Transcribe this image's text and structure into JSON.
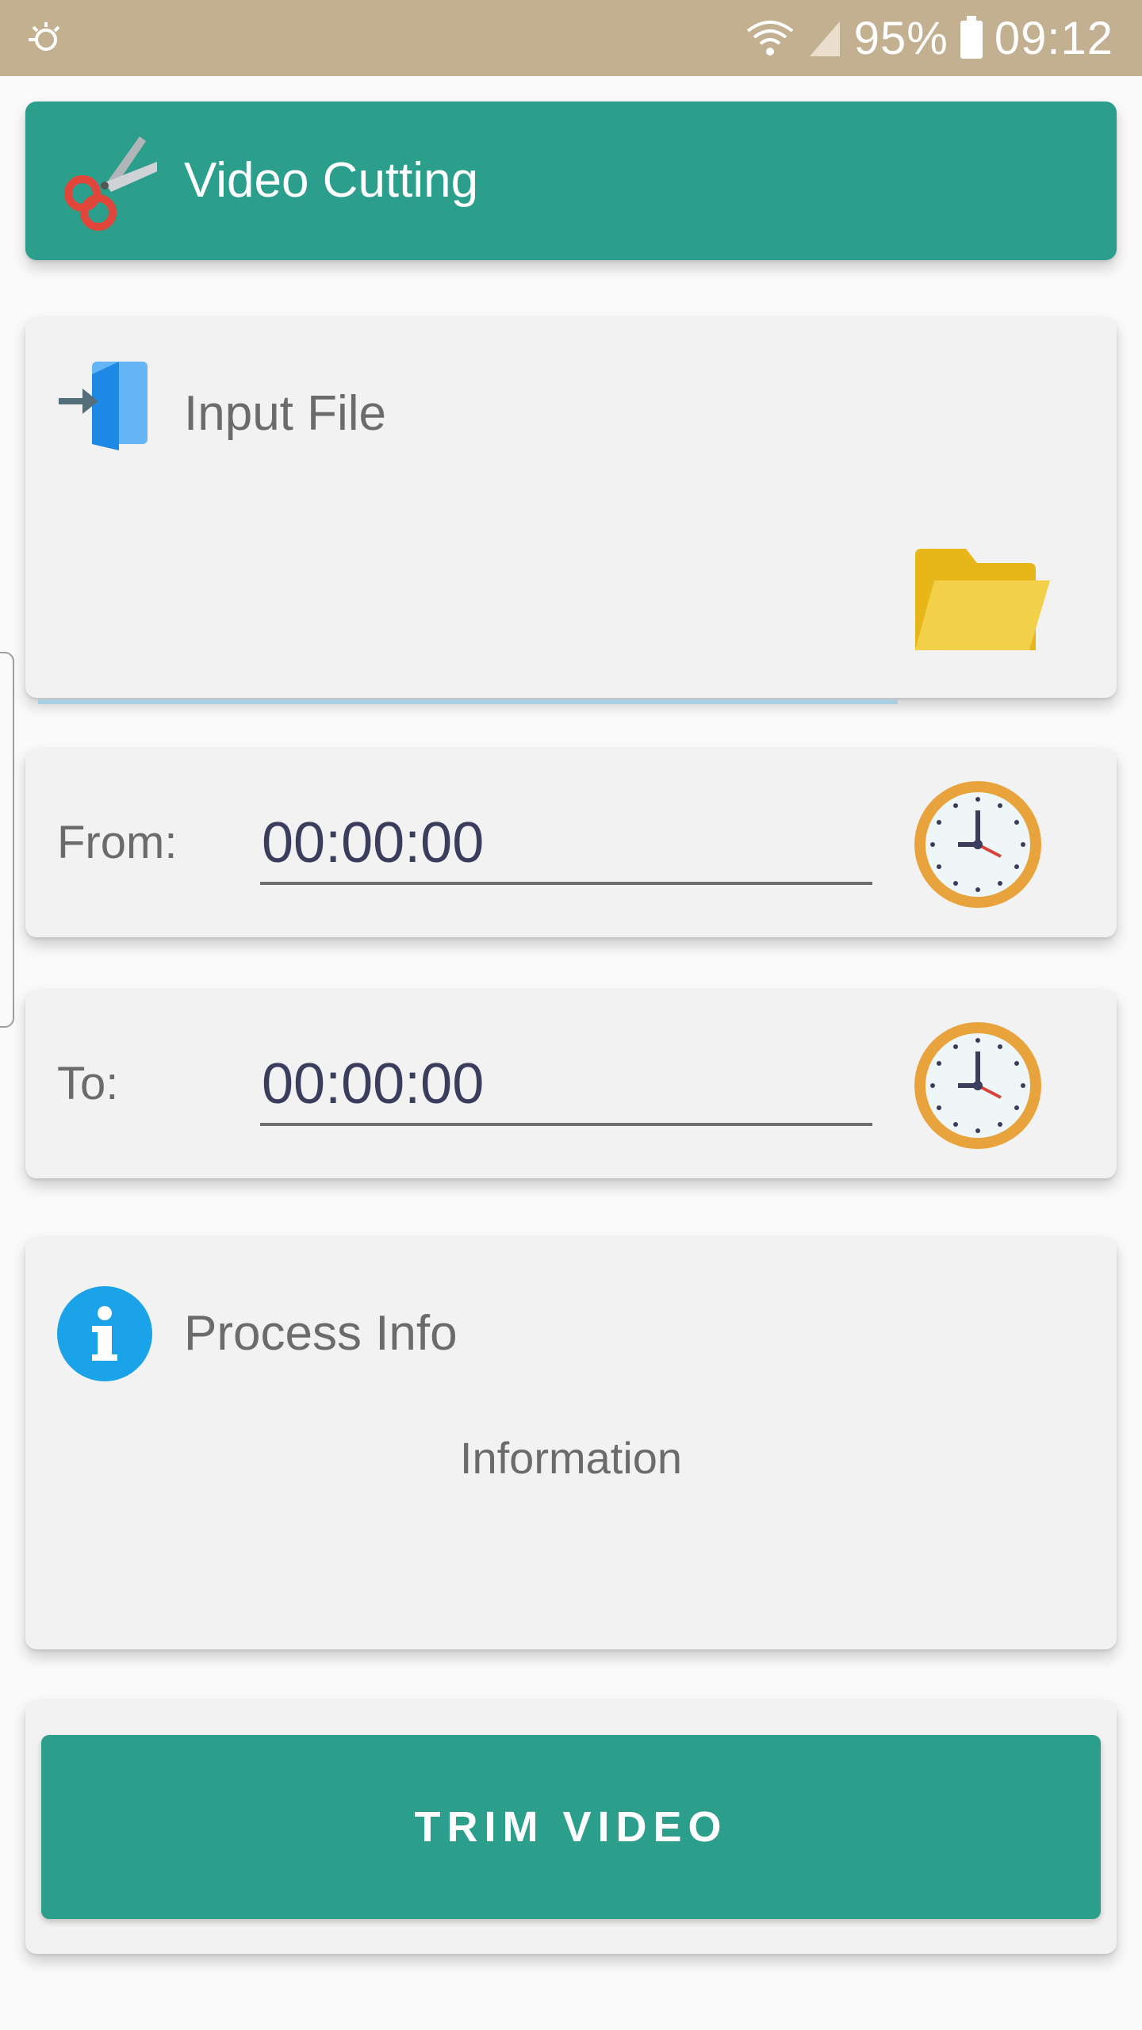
{
  "status_bar": {
    "battery": "95%",
    "time": "09:12",
    "left_icon": "notification-icon",
    "wifi_icon": "wifi-icon",
    "signal_icon": "signal-icon",
    "battery_icon": "battery-icon"
  },
  "header": {
    "title": "Video Cutting",
    "icon": "scissors-icon",
    "color": "#2b9e8c"
  },
  "input_file": {
    "title": "Input File",
    "icon": "input-file-icon",
    "value": "",
    "browse_icon": "folder-icon",
    "underline_color": "#a9cde3"
  },
  "from": {
    "label": "From:",
    "value": "00:00:00",
    "icon": "clock-icon"
  },
  "to": {
    "label": "To:",
    "value": "00:00:00",
    "icon": "clock-icon"
  },
  "process_info": {
    "title": "Process Info",
    "icon": "info-icon",
    "text": "Information"
  },
  "trim_button": {
    "label": "TRIM VIDEO",
    "color": "#2b9e8c"
  }
}
